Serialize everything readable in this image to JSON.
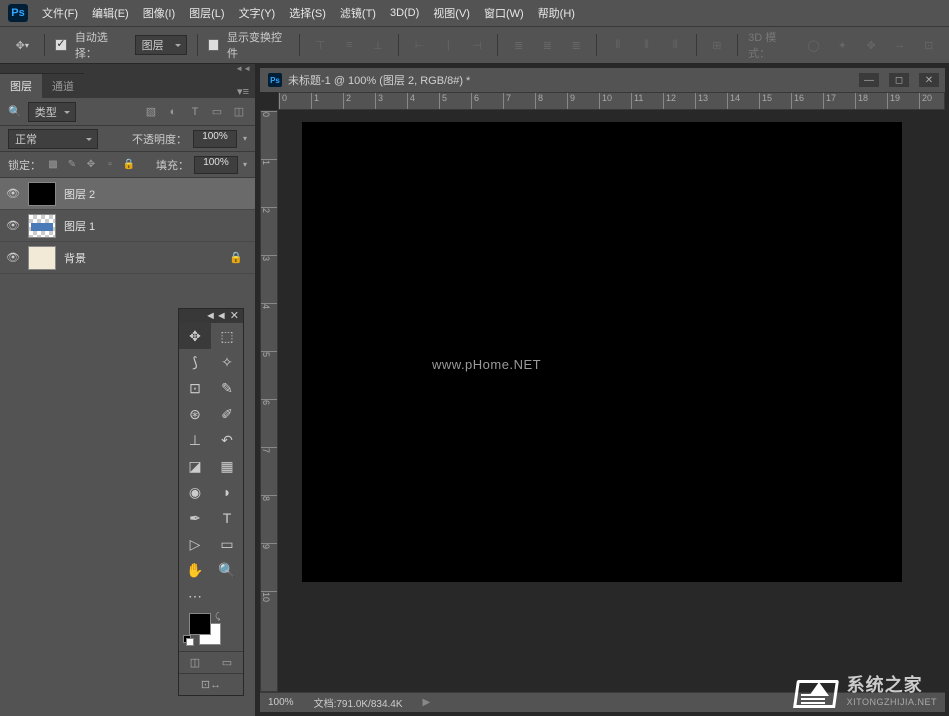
{
  "app": {
    "logo": "Ps"
  },
  "menu": {
    "file": "文件(F)",
    "edit": "编辑(E)",
    "image": "图像(I)",
    "layer": "图层(L)",
    "type": "文字(Y)",
    "select": "选择(S)",
    "filter": "滤镜(T)",
    "d3": "3D(D)",
    "view": "视图(V)",
    "window": "窗口(W)",
    "help": "帮助(H)"
  },
  "options": {
    "auto_select": "自动选择：",
    "target": "图层",
    "transform": "显示变换控件",
    "mode3d": "3D 模式："
  },
  "panel": {
    "layers_tab": "图层",
    "channels_tab": "通道",
    "kind": "类型",
    "blend": "正常",
    "opacity_label": "不透明度：",
    "opacity": "100%",
    "lock_label": "锁定：",
    "fill_label": "填充：",
    "fill": "100%"
  },
  "layers": [
    {
      "name": "图层 2",
      "sel": true,
      "thumb": "black"
    },
    {
      "name": "图层 1",
      "sel": false,
      "thumb": "text"
    },
    {
      "name": "背景",
      "sel": false,
      "thumb": "bg",
      "locked": true
    }
  ],
  "doc": {
    "title": "未标题-1 @ 100% (图层 2, RGB/8#) *"
  },
  "ruler_h": [
    "0",
    "1",
    "2",
    "3",
    "4",
    "5",
    "6",
    "7",
    "8",
    "9",
    "10",
    "11",
    "12",
    "13",
    "14",
    "15",
    "16",
    "17",
    "18",
    "19",
    "20"
  ],
  "ruler_v": [
    "0",
    "1",
    "2",
    "3",
    "4",
    "5",
    "6",
    "7",
    "8",
    "9",
    "10"
  ],
  "canvas": {
    "watermark": "www.pHome.NET"
  },
  "status": {
    "zoom": "100%",
    "doc": "文档:791.0K/834.4K"
  },
  "brand": {
    "name": "系统之家",
    "url": "XITONGZHIJIA.NET"
  }
}
